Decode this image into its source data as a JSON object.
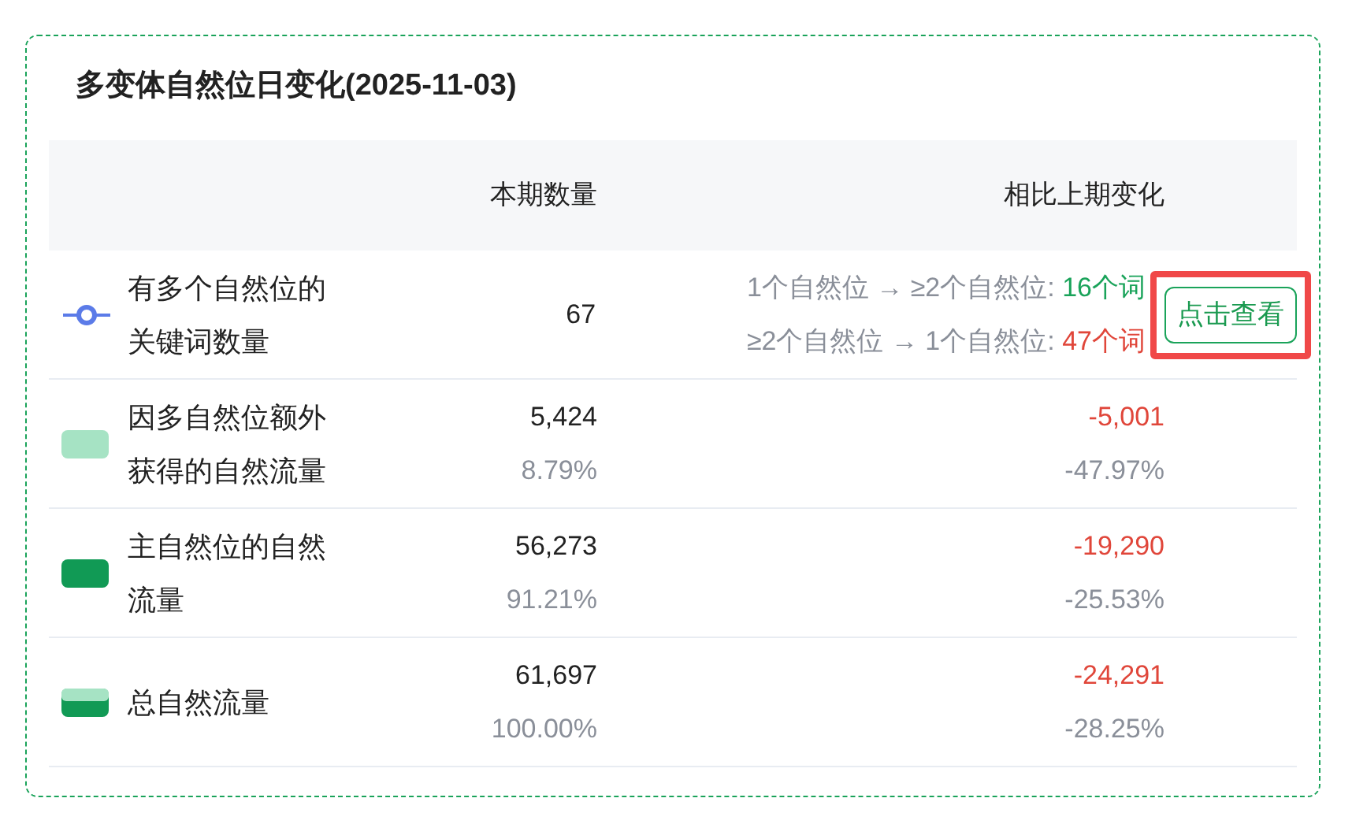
{
  "card": {
    "title": "多变体自然位日变化(2025-11-03)"
  },
  "table": {
    "columns": [
      "本期数量",
      "相比上期变化"
    ],
    "rows": [
      {
        "kind": "line",
        "color": "#5b7be8",
        "label": "有多个自然位的关键词数量",
        "value": "67",
        "change_lines": [
          {
            "text": "1个自然位 → ≥2个自然位: ",
            "count": "16个词",
            "color": "#1aa35a"
          },
          {
            "text": "≥2个自然位 → 1个自然位: ",
            "count": "47个词",
            "color": "#e0463a"
          }
        ],
        "button": "点击查看"
      },
      {
        "kind": "swatch",
        "color": "#a6e3c4",
        "label": "因多自然位额外获得的自然流量",
        "value": "5,424",
        "share": "8.79%",
        "change": {
          "text": "-5,001",
          "color": "#e0463a"
        },
        "change_pct": "-47.97%"
      },
      {
        "kind": "swatch",
        "color": "#119a55",
        "label": "主自然位的自然流量",
        "value": "56,273",
        "share": "91.21%",
        "change": {
          "text": "-19,290",
          "color": "#e0463a"
        },
        "change_pct": "-25.53%"
      },
      {
        "kind": "split",
        "layers": [
          {
            "color": "#a6e3c4"
          },
          {
            "color": "#119a55"
          }
        ],
        "label": "总自然流量",
        "value": "61,697",
        "share": "100.00%",
        "change": {
          "text": "-24,291",
          "color": "#e0463a"
        },
        "change_pct": "-28.25%"
      }
    ]
  }
}
